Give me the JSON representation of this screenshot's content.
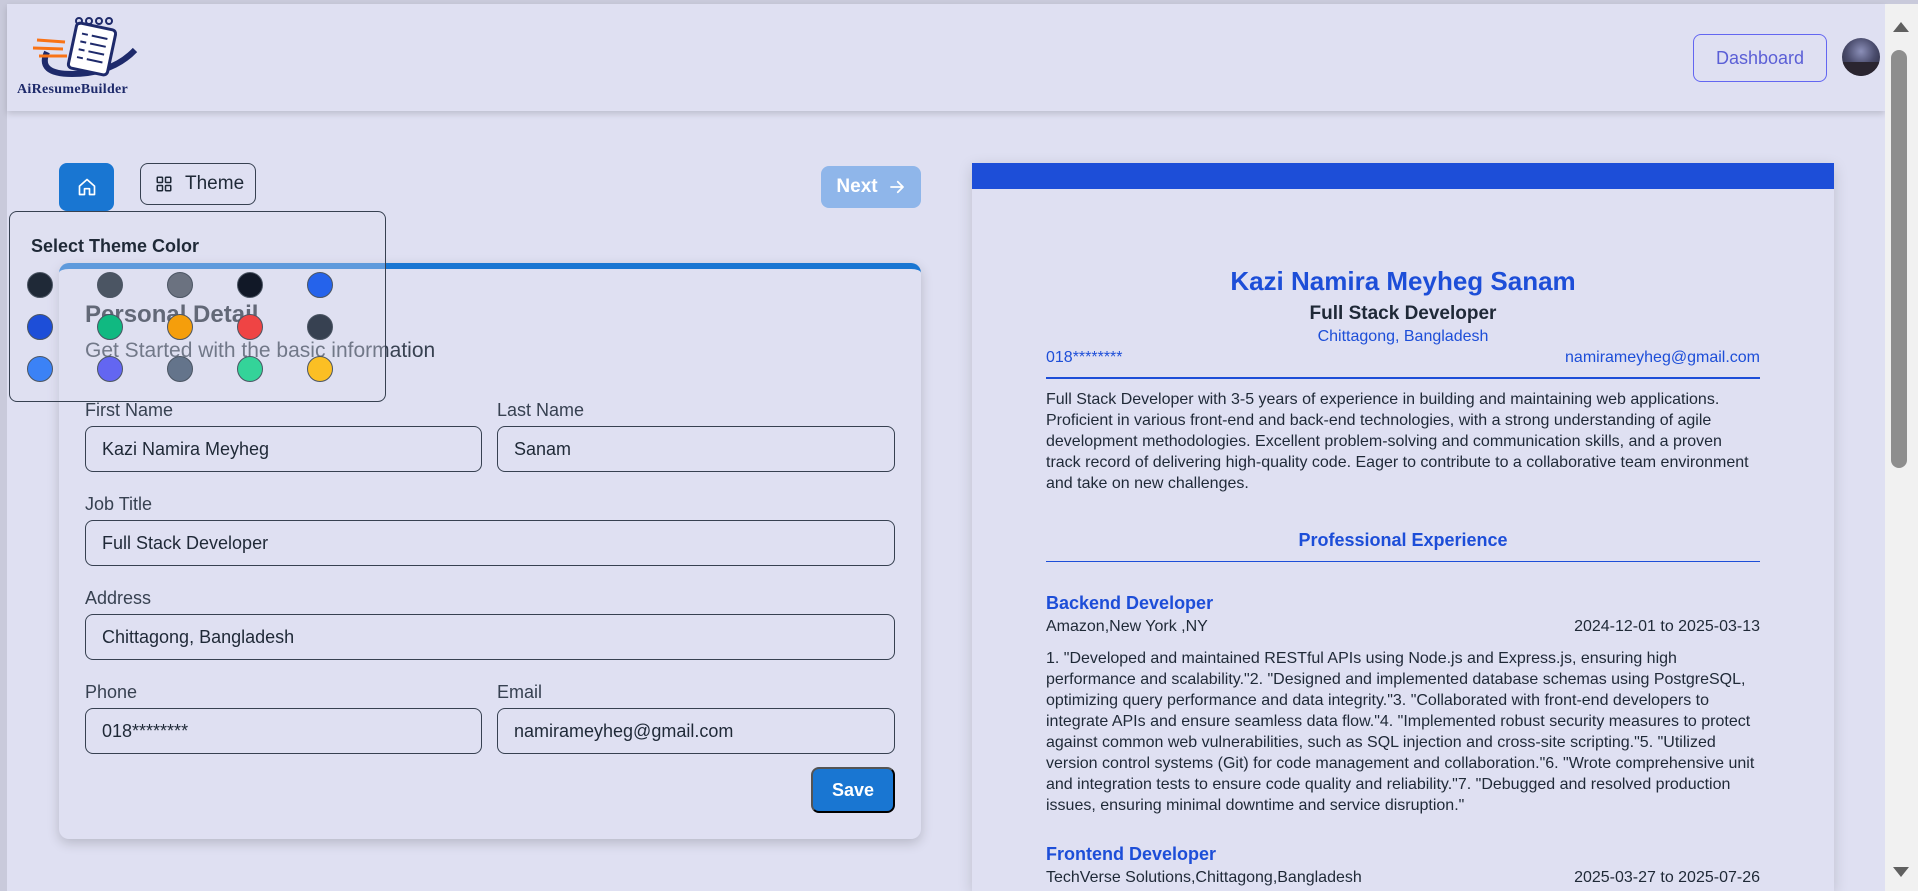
{
  "app": {
    "logo_text": "AiResumeBuilder",
    "dashboard_label": "Dashboard"
  },
  "toolbar": {
    "theme_label": "Theme",
    "next_label": "Next"
  },
  "theme_popover": {
    "title": "Select Theme Color",
    "colors": [
      "#1f2937",
      "#4b5563",
      "#6b7280",
      "#111827",
      "#2563eb",
      "#1d4ed8",
      "#10b981",
      "#f59e0b",
      "#ef4444",
      "#374151",
      "#3b82f6",
      "#6366f1",
      "#64748b",
      "#34d399",
      "#fbbf24"
    ]
  },
  "form": {
    "title": "Personal Detail",
    "subtitle": "Get Started with the basic information",
    "first_name": {
      "label": "First Name",
      "value": "Kazi Namira Meyheg"
    },
    "last_name": {
      "label": "Last Name",
      "value": "Sanam"
    },
    "job_title": {
      "label": "Job Title",
      "value": "Full Stack Developer"
    },
    "address": {
      "label": "Address",
      "value": "Chittagong, Bangladesh"
    },
    "phone": {
      "label": "Phone",
      "value": "018********"
    },
    "email": {
      "label": "Email",
      "value": "namirameyheg@gmail.com"
    },
    "save_label": "Save"
  },
  "resume": {
    "name": "Kazi Namira Meyheg Sanam",
    "job_title": "Full Stack Developer",
    "address": "Chittagong, Bangladesh",
    "phone": "018********",
    "email": "namirameyheg@gmail.com",
    "summary": "Full Stack Developer with 3-5 years of experience in building and maintaining web applications. Proficient in various front-end and back-end technologies, with a strong understanding of agile development methodologies. Excellent problem-solving and communication skills, and a proven track record of delivering high-quality code. Eager to contribute to a collaborative team environment and take on new challenges.",
    "experience_heading": "Professional Experience",
    "experience": [
      {
        "title": "Backend Developer",
        "company": "Amazon,New York ,NY",
        "dates": "2024-12-01 to 2025-03-13",
        "description": "1. \"Developed and maintained RESTful APIs using Node.js and Express.js, ensuring high performance and scalability.\"2.  \"Designed and implemented database schemas using PostgreSQL, optimizing query performance and data integrity.\"3.  \"Collaborated with front-end developers to integrate APIs and ensure seamless data flow.\"4. \"Implemented robust security measures to protect against common web vulnerabilities, such as SQL injection and cross-site scripting.\"5. \"Utilized version control systems (Git) for code management and collaboration.\"6. \"Wrote comprehensive unit and integration tests to ensure code quality and reliability.\"7. \"Debugged and resolved production issues, ensuring minimal downtime and service disruption.\""
      },
      {
        "title": "Frontend Developer",
        "company": "TechVerse Solutions,Chittagong,Bangladesh",
        "dates": "2025-03-27 to 2025-07-26"
      }
    ]
  }
}
